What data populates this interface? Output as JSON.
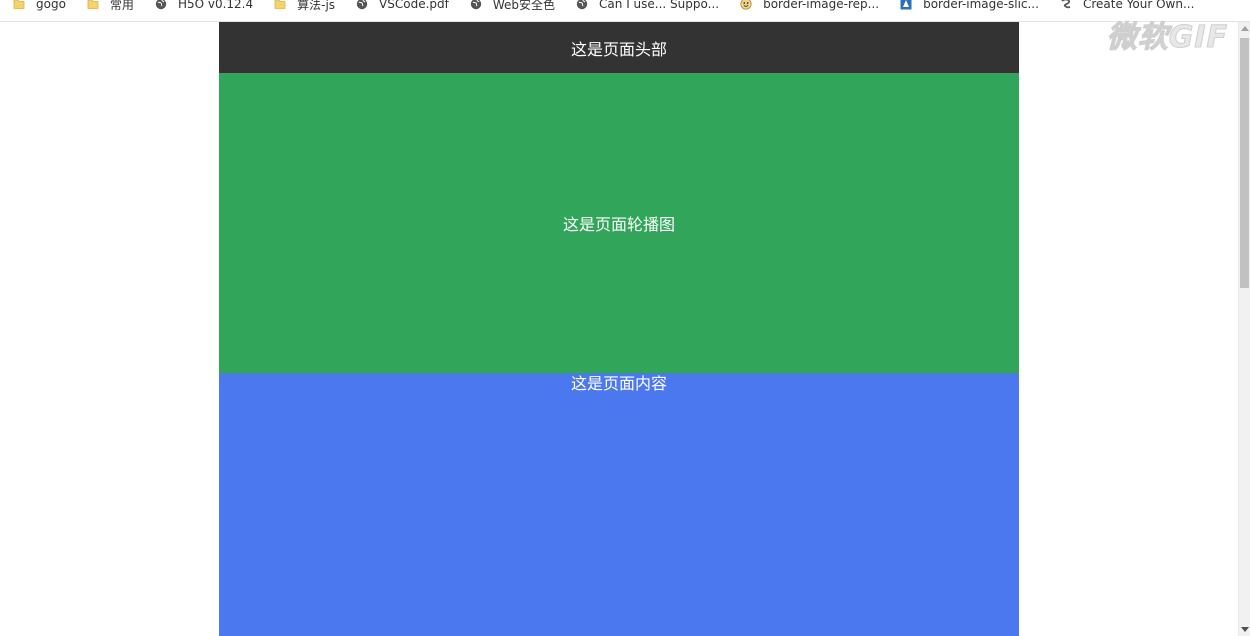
{
  "bookmarks": [
    {
      "label": "gogo",
      "icon": "folder-icon"
    },
    {
      "label": "常用",
      "icon": "folder-icon"
    },
    {
      "label": "H5O v0.12.4",
      "icon": "globe-icon"
    },
    {
      "label": "算法-js",
      "icon": "folder-icon"
    },
    {
      "label": "VSCode.pdf",
      "icon": "globe-icon"
    },
    {
      "label": "Web安全色",
      "icon": "globe-icon"
    },
    {
      "label": "Can I use... Suppo...",
      "icon": "globe-icon"
    },
    {
      "label": "border-image-rep...",
      "icon": "site-icon"
    },
    {
      "label": "border-image-slic...",
      "icon": "site-icon"
    },
    {
      "label": "Create Your Own...",
      "icon": "site-icon"
    }
  ],
  "watermark": "微软GIF",
  "page": {
    "header_text": "这是页面头部",
    "carousel_text": "这是页面轮播图",
    "content_text": "这是页面内容"
  },
  "colors": {
    "header_bg": "#333333",
    "carousel_bg": "#31a55a",
    "content_bg": "#4c78ef"
  }
}
